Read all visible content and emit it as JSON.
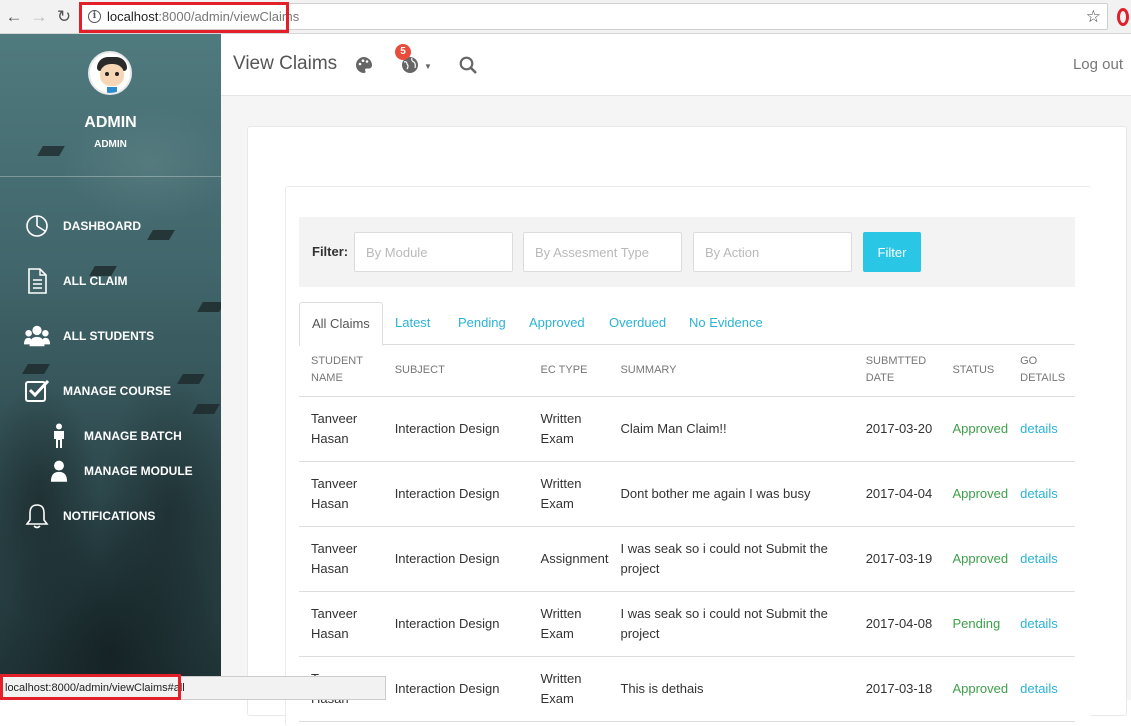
{
  "browser": {
    "url_host": "localhost",
    "url_path": ":8000/admin/viewClaims",
    "status_url": "localhost:8000/admin/viewClaims#all"
  },
  "sidebar": {
    "user_name": "ADMIN",
    "user_role": "ADMIN",
    "items": [
      {
        "label": "DASHBOARD",
        "icon": "pie-chart-icon"
      },
      {
        "label": "ALL CLAIM",
        "icon": "document-icon"
      },
      {
        "label": "ALL STUDENTS",
        "icon": "users-icon"
      },
      {
        "label": "MANAGE COURSE",
        "icon": "checkbox-icon"
      },
      {
        "label": "MANAGE BATCH",
        "icon": "person-icon"
      },
      {
        "label": "MANAGE MODULE",
        "icon": "user-icon"
      },
      {
        "label": "NOTIFICATIONS",
        "icon": "bell-icon"
      }
    ]
  },
  "header": {
    "title": "View Claims",
    "notification_count": "5",
    "logout_label": "Log out"
  },
  "filter": {
    "label": "Filter:",
    "module_placeholder": "By Module",
    "assessment_placeholder": "By Assesment Type",
    "action_placeholder": "By Action",
    "button_label": "Filter"
  },
  "tabs": [
    "All Claims",
    "Latest",
    "Pending",
    "Approved",
    "Overdued",
    "No Evidence"
  ],
  "table": {
    "headers": [
      "STUDENT NAME",
      "SUBJECT",
      "EC TYPE",
      "SUMMARY",
      "SUBMTTED DATE",
      "STATUS",
      "GO DETAILS"
    ],
    "rows": [
      {
        "name": "Tanveer Hasan",
        "subject": "Interaction Design",
        "ec_type": "Written Exam",
        "summary": "Claim Man Claim!!",
        "date": "2017-03-20",
        "status": "Approved",
        "details": "details"
      },
      {
        "name": "Tanveer Hasan",
        "subject": "Interaction Design",
        "ec_type": "Written Exam",
        "summary": "Dont bother me again I was busy",
        "date": "2017-04-04",
        "status": "Approved",
        "details": "details"
      },
      {
        "name": "Tanveer Hasan",
        "subject": "Interaction Design",
        "ec_type": "Assignment",
        "summary": "I was seak so i could not Submit the project",
        "date": "2017-03-19",
        "status": "Approved",
        "details": "details"
      },
      {
        "name": "Tanveer Hasan",
        "subject": "Interaction Design",
        "ec_type": "Written Exam",
        "summary": "I was seak so i could not Submit the project",
        "date": "2017-04-08",
        "status": "Pending",
        "details": "details"
      },
      {
        "name": "Tanveer Hasan",
        "subject": "Interaction Design",
        "ec_type": "Written Exam",
        "summary": "This is dethais",
        "date": "2017-03-18",
        "status": "Approved",
        "details": "details"
      }
    ]
  },
  "colors": {
    "accent": "#2ac6e6",
    "status_approved": "#3ea04a",
    "badge": "#e74c3c",
    "highlight": "#e3202a"
  }
}
